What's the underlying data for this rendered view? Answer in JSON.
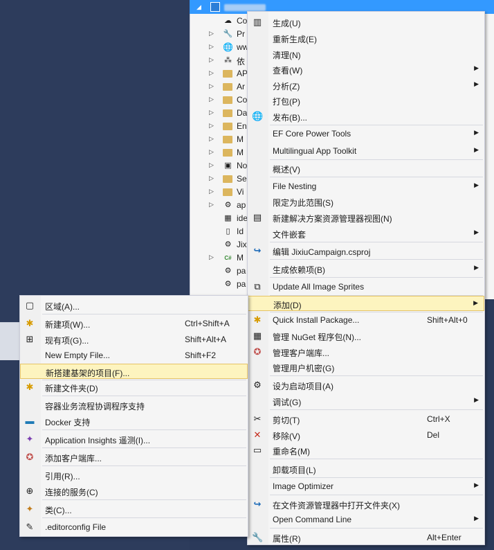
{
  "solution_explorer": {
    "tree_items": [
      {
        "label": "Co",
        "icon": "cloud-icon",
        "glyph": "☁"
      },
      {
        "label": "Pr",
        "icon": "wrench-icon",
        "glyph": "🔧"
      },
      {
        "label": "ww",
        "icon": "globe-icon",
        "glyph": "🌐"
      },
      {
        "label": "依",
        "icon": "dependencies-icon",
        "glyph": "⁂"
      },
      {
        "label": "AP",
        "icon": "folder-icon",
        "glyph": ""
      },
      {
        "label": "Ar",
        "icon": "folder-icon",
        "glyph": ""
      },
      {
        "label": "Co",
        "icon": "folder-icon",
        "glyph": ""
      },
      {
        "label": "Da",
        "icon": "folder-icon",
        "glyph": ""
      },
      {
        "label": "En",
        "icon": "folder-icon",
        "glyph": ""
      },
      {
        "label": "M",
        "icon": "folder-icon",
        "glyph": ""
      },
      {
        "label": "M",
        "icon": "folder-icon",
        "glyph": ""
      },
      {
        "label": "No",
        "icon": "file-icon",
        "glyph": "▣"
      },
      {
        "label": "Se",
        "icon": "folder-icon",
        "glyph": ""
      },
      {
        "label": "Vi",
        "icon": "folder-icon",
        "glyph": ""
      },
      {
        "label": "ap",
        "icon": "json-icon",
        "glyph": "⚙"
      },
      {
        "label": "ide",
        "icon": "config-icon",
        "glyph": "▦"
      },
      {
        "label": "Id",
        "icon": "file-icon",
        "glyph": "▯"
      },
      {
        "label": "Jix",
        "icon": "json-icon",
        "glyph": "⚙"
      },
      {
        "label": "M",
        "icon": "csharp-icon",
        "glyph": "C#"
      },
      {
        "label": "pa",
        "icon": "json-icon",
        "glyph": "⚙"
      },
      {
        "label": "pa",
        "icon": "json-icon",
        "glyph": "⚙"
      }
    ]
  },
  "main_menu": {
    "items": [
      {
        "label": "生成(U)",
        "icon": "build-icon",
        "glyph": "▥"
      },
      {
        "label": "重新生成(E)"
      },
      {
        "label": "清理(N)"
      },
      {
        "label": "查看(W)",
        "submenu": true
      },
      {
        "label": "分析(Z)",
        "submenu": true
      },
      {
        "label": "打包(P)"
      },
      {
        "label": "发布(B)...",
        "icon": "publish-globe-icon",
        "glyph": "🌐"
      },
      {
        "label": "EF Core Power Tools",
        "submenu": true
      },
      {
        "label": "Multilingual App Toolkit",
        "submenu": true
      },
      {
        "label": "概述(V)"
      },
      {
        "label": "File Nesting",
        "submenu": true
      },
      {
        "label": "限定为此范围(S)"
      },
      {
        "label": "新建解决方案资源管理器视图(N)",
        "icon": "new-view-icon",
        "glyph": "▤"
      },
      {
        "label": "文件嵌套",
        "submenu": true
      },
      {
        "label": "编辑 JixiuCampaign.csproj",
        "icon": "edit-redo-icon",
        "glyph": "↪"
      },
      {
        "label": "生成依赖项(B)",
        "submenu": true
      },
      {
        "label": "Update All Image Sprites",
        "icon": "sprites-icon",
        "glyph": "⧉"
      },
      {
        "label": "添加(D)",
        "submenu": true
      },
      {
        "label": "Quick Install Package...",
        "shortcut": "Shift+Alt+0",
        "icon": "quick-install-icon",
        "glyph": "✱"
      },
      {
        "label": "管理 NuGet 程序包(N)...",
        "icon": "nuget-icon",
        "glyph": "▦"
      },
      {
        "label": "管理客户端库...",
        "icon": "client-library-icon",
        "glyph": "✪"
      },
      {
        "label": "管理用户机密(G)"
      },
      {
        "label": "设为启动项目(A)",
        "icon": "gear-icon",
        "glyph": "⚙"
      },
      {
        "label": "调试(G)",
        "submenu": true
      },
      {
        "label": "剪切(T)",
        "shortcut": "Ctrl+X",
        "icon": "scissors-icon",
        "glyph": "✂"
      },
      {
        "label": "移除(V)",
        "shortcut": "Del",
        "icon": "remove-x-icon",
        "glyph": "✕"
      },
      {
        "label": "重命名(M)",
        "icon": "rename-icon",
        "glyph": "▭"
      },
      {
        "label": "卸载项目(L)"
      },
      {
        "label": "Image Optimizer",
        "submenu": true
      },
      {
        "label": "在文件资源管理器中打开文件夹(X)",
        "icon": "open-folder-redo-icon",
        "glyph": "↪"
      },
      {
        "label": "Open Command Line",
        "submenu": true
      },
      {
        "label": "属性(R)",
        "shortcut": "Alt+Enter",
        "icon": "wrench-icon",
        "glyph": "🔧"
      }
    ]
  },
  "add_menu": {
    "items": [
      {
        "label": "区域(A)...",
        "icon": "area-icon",
        "glyph": "▢"
      },
      {
        "label": "新建项(W)...",
        "shortcut": "Ctrl+Shift+A",
        "icon": "new-item-icon",
        "glyph": "✱"
      },
      {
        "label": "现有项(G)...",
        "shortcut": "Shift+Alt+A",
        "icon": "existing-item-icon",
        "glyph": "⊞"
      },
      {
        "label": "New Empty File...",
        "shortcut": "Shift+F2"
      },
      {
        "label": "新搭建基架的项目(F)..."
      },
      {
        "label": "新建文件夹(D)",
        "icon": "new-folder-icon",
        "glyph": "✱"
      },
      {
        "label": "容器业务流程协调程序支持"
      },
      {
        "label": "Docker 支持",
        "icon": "docker-icon",
        "glyph": "▬"
      },
      {
        "label": "Application Insights 遥测(I)...",
        "icon": "insights-bulb-icon",
        "glyph": "✦"
      },
      {
        "label": "添加客户端库...",
        "icon": "client-library-icon",
        "glyph": "✪"
      },
      {
        "label": "引用(R)..."
      },
      {
        "label": "连接的服务(C)",
        "icon": "connected-service-icon",
        "glyph": "⊕"
      },
      {
        "label": "类(C)...",
        "icon": "class-icon",
        "glyph": "✦"
      },
      {
        "label": ".editorconfig File",
        "icon": "editorconfig-icon",
        "glyph": "✎"
      }
    ]
  },
  "colors": {
    "highlight_bg": "#fdf4bf",
    "highlight_border": "#e5c365",
    "selection_blue": "#3399ff",
    "menu_bg": "#f5f5f5"
  }
}
